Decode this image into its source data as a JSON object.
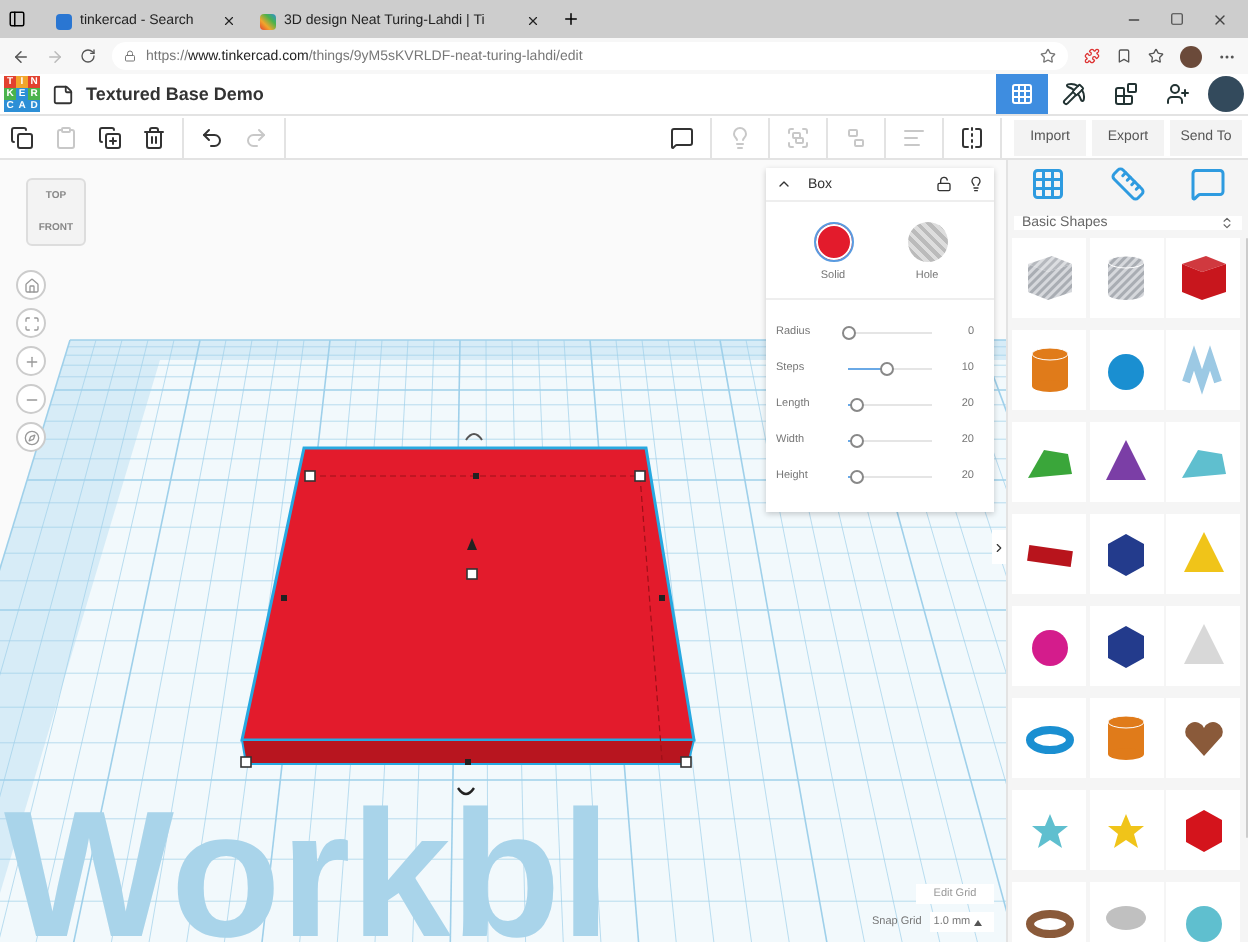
{
  "browser": {
    "tabs": [
      {
        "label": "tinkercad - Search",
        "selected": false
      },
      {
        "label": "3D design Neat Turing-Lahdi | Ti",
        "selected": true
      }
    ],
    "url": {
      "scheme": "https://",
      "host": "www.tinkercad.com",
      "path": "/things/9yM5sKVRLDF-neat-turing-lahdi/edit"
    }
  },
  "app": {
    "logo": [
      {
        "letter": "T",
        "color": "#e2412f"
      },
      {
        "letter": "I",
        "color": "#f2a52c"
      },
      {
        "letter": "N",
        "color": "#e2412f"
      },
      {
        "letter": "K",
        "color": "#4ab34c"
      },
      {
        "letter": "E",
        "color": "#2d8fd6"
      },
      {
        "letter": "R",
        "color": "#4ab34c"
      },
      {
        "letter": "C",
        "color": "#2d8fd6"
      },
      {
        "letter": "A",
        "color": "#2d8fd6"
      },
      {
        "letter": "D",
        "color": "#2d8fd6"
      }
    ],
    "title": "Textured Base Demo",
    "views": [
      {
        "kind": "design",
        "selected": true
      },
      {
        "kind": "build",
        "selected": false
      },
      {
        "kind": "bricks",
        "selected": false
      }
    ]
  },
  "toolbar": {
    "left": [
      {
        "kind": "copy",
        "disabled": false
      },
      {
        "kind": "paste",
        "disabled": true
      },
      {
        "kind": "duplicate",
        "disabled": false
      },
      {
        "kind": "delete",
        "disabled": false
      },
      {
        "kind": "undo",
        "disabled": false
      },
      {
        "kind": "redo",
        "disabled": true
      }
    ],
    "right": [
      {
        "kind": "notes",
        "disabled": false
      },
      {
        "kind": "light",
        "disabled": true
      },
      {
        "kind": "group",
        "disabled": true
      },
      {
        "kind": "ungroup",
        "disabled": true
      },
      {
        "kind": "align",
        "disabled": true
      },
      {
        "kind": "mirror",
        "disabled": false
      }
    ],
    "actions": [
      "Import",
      "Export",
      "Send To"
    ]
  },
  "view_cube": {
    "top": "TOP",
    "front": "FRONT"
  },
  "workplane_text": "Workbl",
  "inspector": {
    "title": "Box",
    "modes": [
      {
        "label": "Solid",
        "selected": true
      },
      {
        "label": "Hole",
        "selected": false
      }
    ],
    "params": [
      {
        "name": "Radius",
        "level": 0,
        "reading": "0"
      },
      {
        "name": "Steps",
        "level": 0.45,
        "reading": "10"
      },
      {
        "name": "Length",
        "level": 0.1,
        "reading": "20"
      },
      {
        "name": "Width",
        "level": 0.1,
        "reading": "20"
      },
      {
        "name": "Height",
        "level": 0.1,
        "reading": "20"
      }
    ]
  },
  "grid": {
    "edit": "Edit Grid",
    "snap_label": "Snap Grid",
    "snap_value": "1.0 mm"
  },
  "library": {
    "category": "Basic Shapes",
    "shapes": [
      {
        "kind": "box-hole",
        "color": "#b8bcc2"
      },
      {
        "kind": "cylinder-hole",
        "color": "#b8bcc2"
      },
      {
        "kind": "box",
        "color": "#c8161d"
      },
      {
        "kind": "cylinder",
        "color": "#e07b1a"
      },
      {
        "kind": "sphere",
        "color": "#1a8fd1"
      },
      {
        "kind": "scribble",
        "color": "#9cc9e4"
      },
      {
        "kind": "roof",
        "color": "#3aa63a"
      },
      {
        "kind": "cone",
        "color": "#7b3ea6"
      },
      {
        "kind": "round-roof",
        "color": "#5fbfcf"
      },
      {
        "kind": "text",
        "color": "#b8141c"
      },
      {
        "kind": "polygon",
        "color": "#233b8c"
      },
      {
        "kind": "pyramid",
        "color": "#f0c419"
      },
      {
        "kind": "half-sphere",
        "color": "#d41c8c"
      },
      {
        "kind": "prism",
        "color": "#233b8c"
      },
      {
        "kind": "paraboloid",
        "color": "#d8d8d8"
      },
      {
        "kind": "torus",
        "color": "#1a8fd1"
      },
      {
        "kind": "tube",
        "color": "#e07b1a"
      },
      {
        "kind": "heart",
        "color": "#8a5a3a"
      },
      {
        "kind": "star",
        "color": "#5fbfcf"
      },
      {
        "kind": "star-thick",
        "color": "#f0c419"
      },
      {
        "kind": "icosahedron",
        "color": "#d4141c"
      },
      {
        "kind": "ring",
        "color": "#8a5a3a"
      },
      {
        "kind": "disc",
        "color": "#c0c0c0"
      },
      {
        "kind": "dome",
        "color": "#5fbfcf"
      }
    ]
  }
}
